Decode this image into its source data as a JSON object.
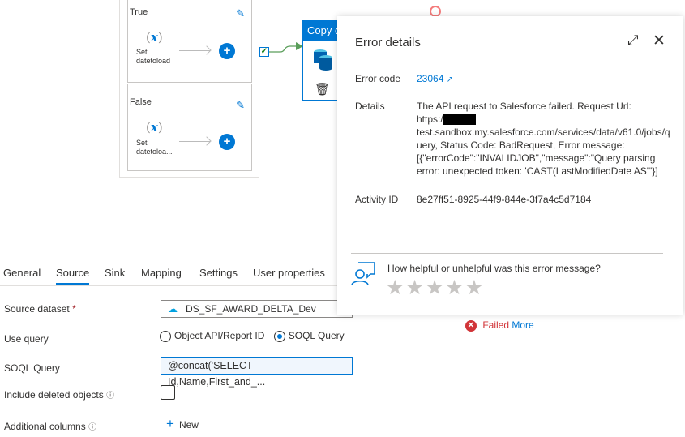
{
  "canvas": {
    "branches": [
      {
        "title": "True",
        "activity": "Set datetoload",
        "activity_lines": [
          "Set",
          "datetoload"
        ]
      },
      {
        "title": "False",
        "activity": "Set datetoloa...",
        "activity_lines": [
          "Set",
          "datetoloa..."
        ]
      }
    ],
    "copy_activity_title": "Copy data",
    "fx_symbol": "x"
  },
  "error_panel": {
    "title": "Error details",
    "error_code_label": "Error code",
    "error_code": "23064",
    "details_label": "Details",
    "details_lines": [
      "The API request to Salesforce failed. Request Url:",
      "https:/",
      "test.sandbox.my.salesforce.com/services/data/v61.0/jobs/q",
      "uery, Status Code: BadRequest, Error message:",
      "[{\"errorCode\":\"INVALIDJOB\",\"message\":\"Query parsing",
      "error: unexpected token: 'CAST(LastModifiedDate AS'\"}]"
    ],
    "activity_id_label": "Activity ID",
    "activity_id": "8e27ff51-8925-44f9-844e-3f7a4c5d7184",
    "feedback_question": "How helpful or unhelpful was this error message?",
    "rating": 0,
    "rating_max": 5
  },
  "tabs": [
    "General",
    "Source",
    "Sink",
    "Mapping",
    "Settings",
    "User properties"
  ],
  "active_tab": "Source",
  "form": {
    "source_dataset_label": "Source dataset",
    "required_mark": "*",
    "source_dataset_value": "DS_SF_AWARD_DELTA_Dev",
    "use_query_label": "Use query",
    "use_query_options": [
      "Object API/Report ID",
      "SOQL Query"
    ],
    "use_query_selected": "SOQL Query",
    "soql_label": "SOQL Query",
    "soql_value": "@concat('SELECT Id,Name,First_and_...",
    "include_deleted_label": "Include deleted objects",
    "include_deleted_checked": false,
    "additional_columns_label": "Additional columns",
    "new_label": "New"
  },
  "status": {
    "text": "Failed",
    "more": "More"
  },
  "colors": {
    "accent": "#0078d4",
    "error": "#d13438",
    "success": "#107c10"
  }
}
